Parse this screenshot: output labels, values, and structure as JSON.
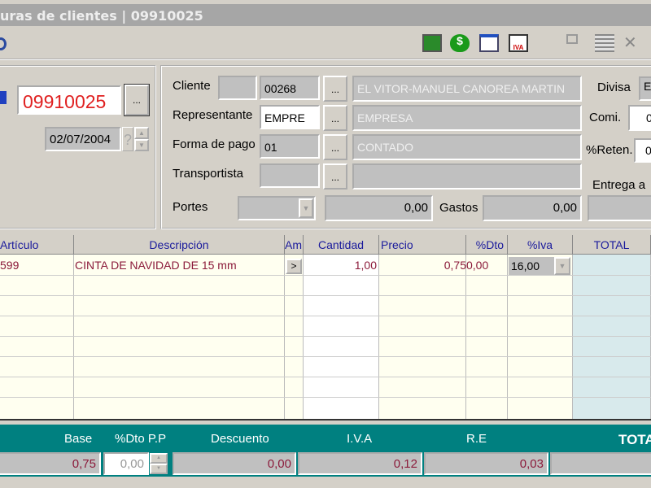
{
  "window": {
    "title": "uras de clientes | 09910025"
  },
  "header": {
    "number_value": "09910025",
    "date_value": "02/07/2004",
    "date_help": "?",
    "cliente_label": "Cliente",
    "cliente_code": "00268",
    "cliente_name": "EL VITOR-MANUEL CANOREA MARTIN",
    "representante_label": "Representante",
    "representante_code": "EMPRE",
    "representante_name": "EMPRESA",
    "forma_pago_label": "Forma de pago",
    "forma_pago_code": "01",
    "forma_pago_name": "CONTADO",
    "transportista_label": "Transportista",
    "portes_label": "Portes",
    "portes_value": "0,00",
    "gastos_label": "Gastos",
    "gastos_value": "0,00",
    "divisa_label": "Divisa",
    "divisa_value": "E",
    "comi_label": "Comi.",
    "comi_value": "0",
    "reten_label": "%Reten.",
    "reten_value": "0",
    "entrega_label": "Entrega a",
    "dots": "..."
  },
  "grid": {
    "columns": [
      "Artículo",
      "Descripción",
      "Am",
      "Cantidad",
      "Precio",
      "%Dto",
      "%Iva",
      "TOTAL"
    ],
    "rows": [
      {
        "articulo": "599",
        "descripcion": "CINTA DE NAVIDAD DE 15 mm",
        "am": ">",
        "cantidad": "1,00",
        "precio": "0,75",
        "dto": "0,00",
        "iva": "16,00",
        "total": ""
      }
    ]
  },
  "totals": {
    "labels": {
      "base": "Base",
      "dto_pp": "%Dto P.P",
      "descuento": "Descuento",
      "iva": "I.V.A",
      "re": "R.E",
      "total": "TOTA"
    },
    "values": {
      "base": "0,75",
      "dto_pp": "0,00",
      "descuento": "0,00",
      "iva": "0,12",
      "re": "0,03",
      "total": ""
    }
  },
  "colors": {
    "accent": "#008080",
    "number": "#e02020",
    "grid_text": "#8b1a3a"
  }
}
